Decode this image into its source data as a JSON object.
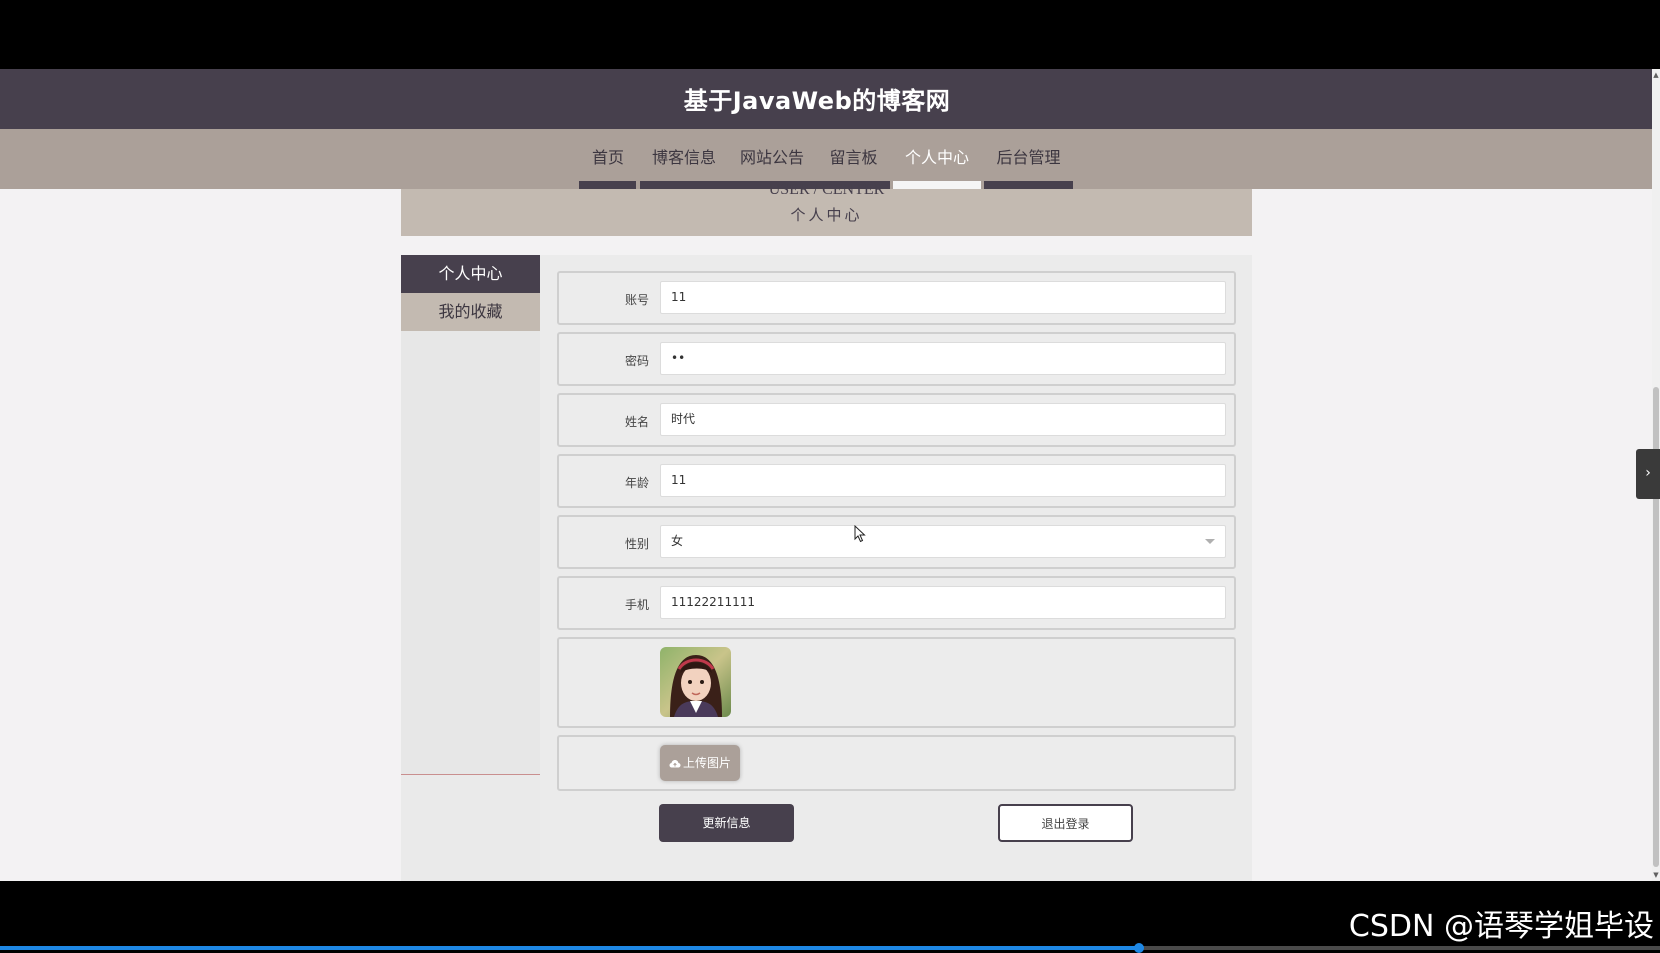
{
  "header": {
    "title": "基于JavaWeb的博客网"
  },
  "nav": {
    "items": [
      {
        "label": "首页",
        "active": false
      },
      {
        "label": "博客信息",
        "active": false
      },
      {
        "label": "网站公告",
        "active": false
      },
      {
        "label": "留言板",
        "active": false
      },
      {
        "label": "个人中心",
        "active": true
      },
      {
        "label": "后台管理",
        "active": false
      }
    ]
  },
  "banner": {
    "en": "USER / CENTER",
    "zh": "个人中心"
  },
  "sidebar": {
    "items": [
      {
        "label": "个人中心",
        "active": true
      },
      {
        "label": "我的收藏",
        "active": false
      }
    ]
  },
  "form": {
    "account": {
      "label": "账号",
      "value": "11"
    },
    "password": {
      "label": "密码",
      "value": "••"
    },
    "name": {
      "label": "姓名",
      "value": "时代"
    },
    "age": {
      "label": "年龄",
      "value": "11"
    },
    "gender": {
      "label": "性别",
      "value": "女"
    },
    "phone": {
      "label": "手机",
      "value": "11122211111"
    },
    "upload_label": "上传图片"
  },
  "buttons": {
    "update": "更新信息",
    "logout": "退出登录"
  },
  "watermark": "CSDN @语琴学姐毕设",
  "video": {
    "progress": 0.686
  },
  "colors": {
    "header": "#47404d",
    "nav": "#aba099",
    "banner": "#c3bab1",
    "accent": "#1e88e5"
  }
}
